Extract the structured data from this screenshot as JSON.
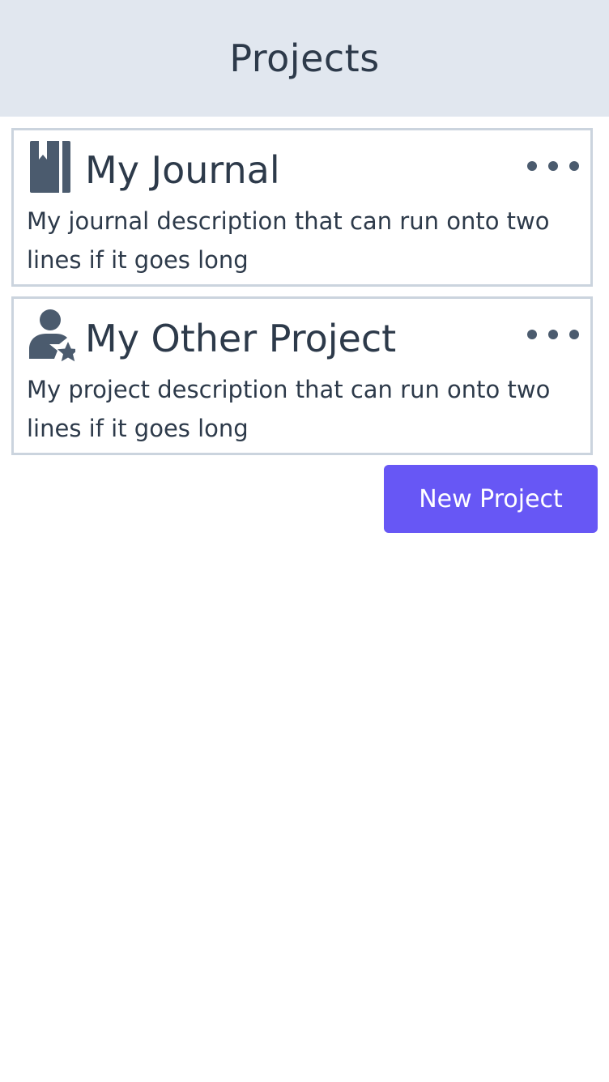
{
  "header": {
    "title": "Projects"
  },
  "projects": [
    {
      "icon": "journal-book-icon",
      "title": "My Journal",
      "description": "My journal description that can run onto two lines if it goes long",
      "menu_icon": "more-options-icon"
    },
    {
      "icon": "user-star-icon",
      "title": "My Other Project",
      "description": "My project description that can run onto two lines if it goes long",
      "menu_icon": "more-options-icon"
    }
  ],
  "actions": {
    "new_project_label": "New Project"
  },
  "colors": {
    "header_bg": "#e1e7ef",
    "text": "#2d3a4a",
    "icon": "#4b5b6e",
    "card_border": "#cbd4de",
    "primary_button": "#6757f5"
  }
}
